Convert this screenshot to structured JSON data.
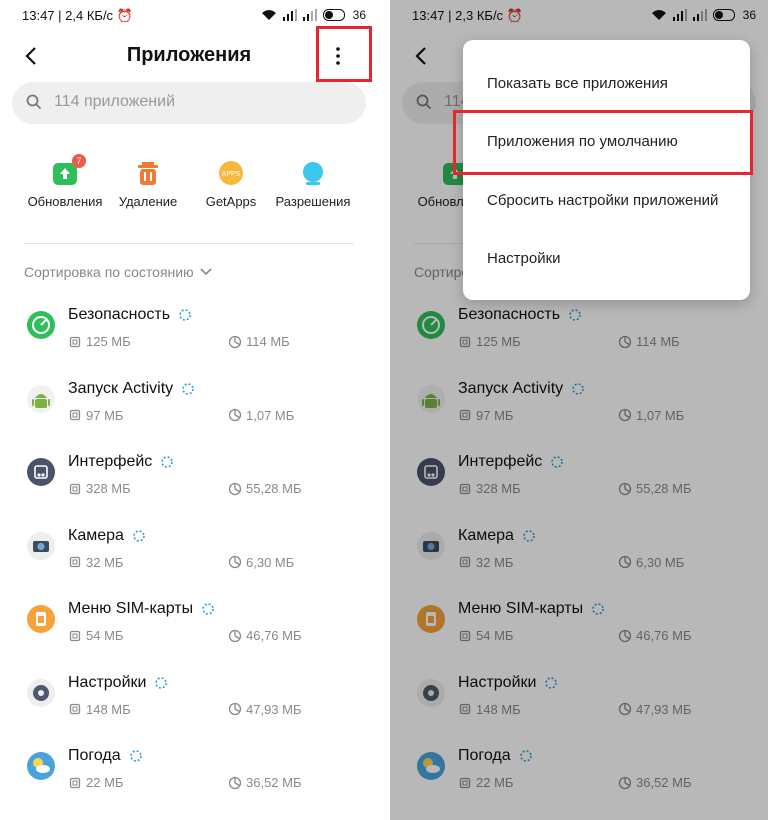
{
  "status_left": {
    "time": "13:47",
    "speed": "2,4 КБ/с",
    "battery": "36"
  },
  "status_right": {
    "time": "13:47",
    "speed": "2,3 КБ/с",
    "battery": "36"
  },
  "header": {
    "title": "Приложения"
  },
  "search": {
    "placeholder": "114 приложений"
  },
  "quick_actions": [
    {
      "label": "Обновления",
      "badge": "7",
      "icon": "update-icon",
      "color": "#2fbf5a"
    },
    {
      "label": "Удаление",
      "icon": "trash-icon",
      "color": "#f07a32"
    },
    {
      "label": "GetApps",
      "icon": "getapps-icon",
      "color": "#f6b93b"
    },
    {
      "label": "Разрешения",
      "icon": "permissions-icon",
      "color": "#3cc6ec"
    }
  ],
  "sort": {
    "label": "Сортировка по состоянию"
  },
  "apps": [
    {
      "name": "Безопасность",
      "size": "125 МБ",
      "cache": "114 МБ",
      "icon": "security-icon"
    },
    {
      "name": "Запуск Activity",
      "size": "97 МБ",
      "cache": "1,07 МБ",
      "icon": "android-icon"
    },
    {
      "name": "Интерфейс",
      "size": "328 МБ",
      "cache": "55,28 МБ",
      "icon": "interface-icon"
    },
    {
      "name": "Камера",
      "size": "32 МБ",
      "cache": "6,30 МБ",
      "icon": "camera-icon"
    },
    {
      "name": "Меню SIM-карты",
      "size": "54 МБ",
      "cache": "46,76 МБ",
      "icon": "sim-icon"
    },
    {
      "name": "Настройки",
      "size": "148 МБ",
      "cache": "47,93 МБ",
      "icon": "settings-icon"
    },
    {
      "name": "Погода",
      "size": "22 МБ",
      "cache": "36,52 МБ",
      "icon": "weather-icon"
    }
  ],
  "menu": [
    {
      "label": "Показать все приложения"
    },
    {
      "label": "Приложения по умолчанию"
    },
    {
      "label": "Сбросить настройки приложений"
    },
    {
      "label": "Настройки"
    }
  ],
  "colors": {
    "highlight": "#e3262f",
    "accent_spinner": "#2d9cdb"
  }
}
